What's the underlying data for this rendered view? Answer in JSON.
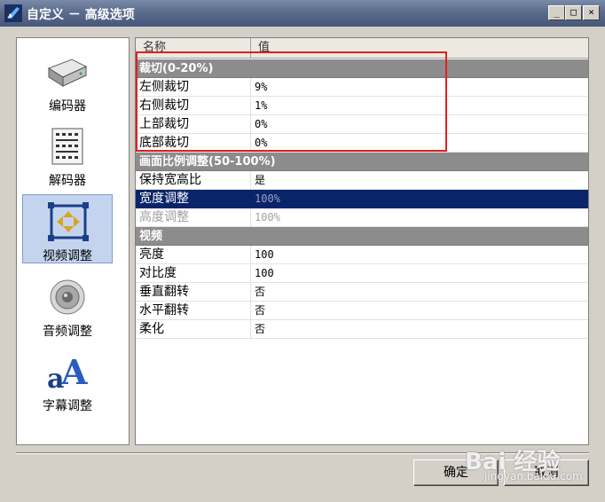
{
  "window": {
    "title": "自定义 － 高级选项",
    "controls": {
      "minimize": "_",
      "maximize": "□",
      "close": "×"
    }
  },
  "sidebar": {
    "items": [
      {
        "label": "编码器",
        "icon": "hard-drive-icon",
        "selected": false
      },
      {
        "label": "解码器",
        "icon": "circuit-board-icon",
        "selected": false
      },
      {
        "label": "视频调整",
        "icon": "resize-arrows-icon",
        "selected": true
      },
      {
        "label": "音频调整",
        "icon": "speaker-icon",
        "selected": false
      },
      {
        "label": "字幕调整",
        "icon": "font-letter-a-icon",
        "selected": false
      }
    ]
  },
  "grid": {
    "headers": {
      "name": "名称",
      "value": "值"
    },
    "sections": [
      {
        "title": "裁切(0-20%)",
        "rows": [
          {
            "name": "左侧裁切",
            "value": "9%"
          },
          {
            "name": "右侧裁切",
            "value": "1%"
          },
          {
            "name": "上部裁切",
            "value": "0%"
          },
          {
            "name": "底部裁切",
            "value": "0%"
          }
        ]
      },
      {
        "title": "画面比例调整(50-100%)",
        "rows": [
          {
            "name": "保持宽高比",
            "value": "是"
          },
          {
            "name": "宽度调整",
            "value": "100%",
            "state": "selected"
          },
          {
            "name": "高度调整",
            "value": "100%",
            "state": "disabled"
          }
        ]
      },
      {
        "title": "视频",
        "rows": [
          {
            "name": "亮度",
            "value": "100"
          },
          {
            "name": "对比度",
            "value": "100"
          },
          {
            "name": "垂直翻转",
            "value": "否"
          },
          {
            "name": "水平翻转",
            "value": "否"
          },
          {
            "name": "柔化",
            "value": "否"
          }
        ]
      }
    ]
  },
  "buttons": {
    "ok": "确定",
    "cancel": "取消"
  },
  "watermark": {
    "logo": "Bai 经验",
    "url": "jingyan.baidu.com"
  },
  "colors": {
    "selection": "#0a246a",
    "category": "#8c8c8c",
    "highlight_box": "#e02020",
    "titlebar": "#5b6c8c"
  }
}
